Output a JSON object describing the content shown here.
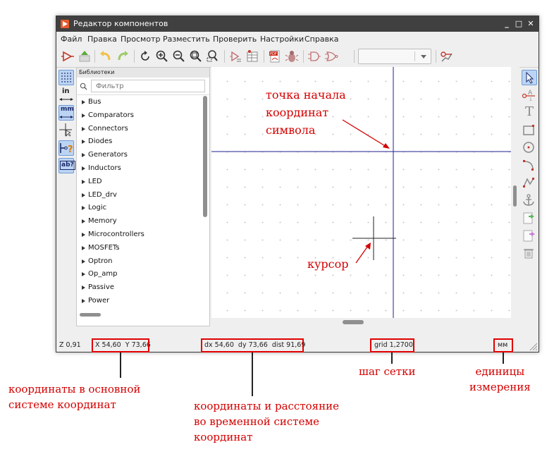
{
  "window": {
    "title": "Редактор компонентов",
    "buttons": [
      "_",
      "□",
      "✕"
    ]
  },
  "menu": [
    "Файл",
    "Правка",
    "Просмотр",
    "Разместить",
    "Проверить",
    "Настройки",
    "Справка"
  ],
  "toolbar": {
    "icons": [
      "new-symbol-icon",
      "save-library-icon",
      "undo-icon",
      "redo-icon",
      "refresh-icon",
      "zoom-in-icon",
      "zoom-out-icon",
      "zoom-fit-icon",
      "zoom-selection-icon",
      "symbol-properties-icon",
      "pin-table-icon",
      "export-pdf-icon",
      "bug-check-icon",
      "de-morgan-normal-icon",
      "de-morgan-alternate-icon",
      "unit-select-combo",
      "pin-editor-icon"
    ]
  },
  "left_tools": {
    "icons": [
      "grid-icon",
      "inches-icon",
      "millimeters-icon",
      "cursor-shape-icon",
      "pin-show-icon",
      "text-show-icon"
    ],
    "inches_label": "in",
    "mm_label": "mm",
    "text_label": "ab?"
  },
  "libraries": {
    "header": "Библиотеки",
    "filter_placeholder": "Фильтр",
    "items": [
      "Bus",
      "Comparators",
      "Connectors",
      "Diodes",
      "Generators",
      "Inductors",
      "LED",
      "LED_drv",
      "Logic",
      "Memory",
      "Microcontrollers",
      "MOSFETs",
      "Optron",
      "Op_amp",
      "Passive",
      "Power"
    ]
  },
  "right_tools": {
    "icons": [
      "select-arrow-icon",
      "add-pin-icon",
      "add-text-icon",
      "add-rectangle-icon",
      "add-circle-icon",
      "add-arc-icon",
      "add-polyline-icon",
      "anchor-icon",
      "import-icon",
      "export-icon",
      "delete-icon"
    ],
    "text_label": "T"
  },
  "status": {
    "zoom": "Z 0,91",
    "xy": "X 54,60  Y 73,66",
    "delta": "dx 54,60  dy 73,66  dist 91,69",
    "grid": "grid 1,2700",
    "units": "мм"
  },
  "annotations": {
    "origin": [
      "точка начала",
      "координат",
      "символа"
    ],
    "cursor": "курсор",
    "main_coords": [
      "координаты в основной",
      "системе координат"
    ],
    "relative_coords": [
      "координаты и расстояние",
      "во временной системе",
      "координат"
    ],
    "grid_step": "шаг сетки",
    "units": [
      "единицы",
      "измерения"
    ]
  },
  "colors": {
    "annotation": "#d40000",
    "axis": "#1f1f8f",
    "titlebar": "#404040",
    "toggle_active": "#bcd4f3"
  }
}
